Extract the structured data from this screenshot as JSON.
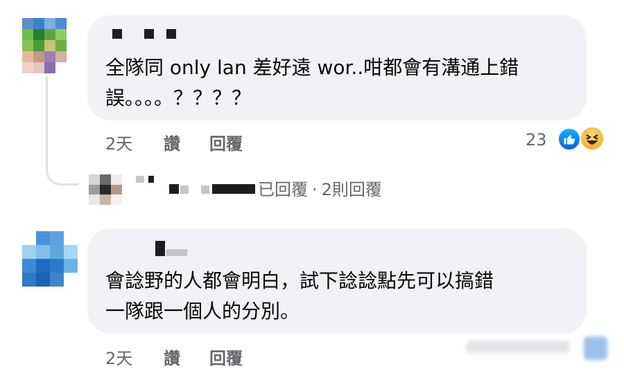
{
  "comments": [
    {
      "text": "全隊同 only lan 差好遠 wor..咁都會有溝通上錯\n誤。。。。？？？？",
      "time": "2天",
      "like_label": "讚",
      "reply_label": "回覆",
      "reaction_count": "23",
      "reactions": [
        "like-icon",
        "haha-icon"
      ]
    },
    {
      "text": "會諗野的人都會明白，試下諗諗點先可以搞錯\n一隊跟一個人的分別。",
      "time": "2天",
      "like_label": "讚",
      "reply_label": "回覆"
    }
  ],
  "reply_summary": {
    "replied_label": "已回覆",
    "separator": "·",
    "count_label": "2則回覆"
  },
  "colors": {
    "bubble": "#f0f2f5",
    "meta_text": "#65676b",
    "like_blue": "#1877f2",
    "haha_yellow": "#f7b125"
  }
}
